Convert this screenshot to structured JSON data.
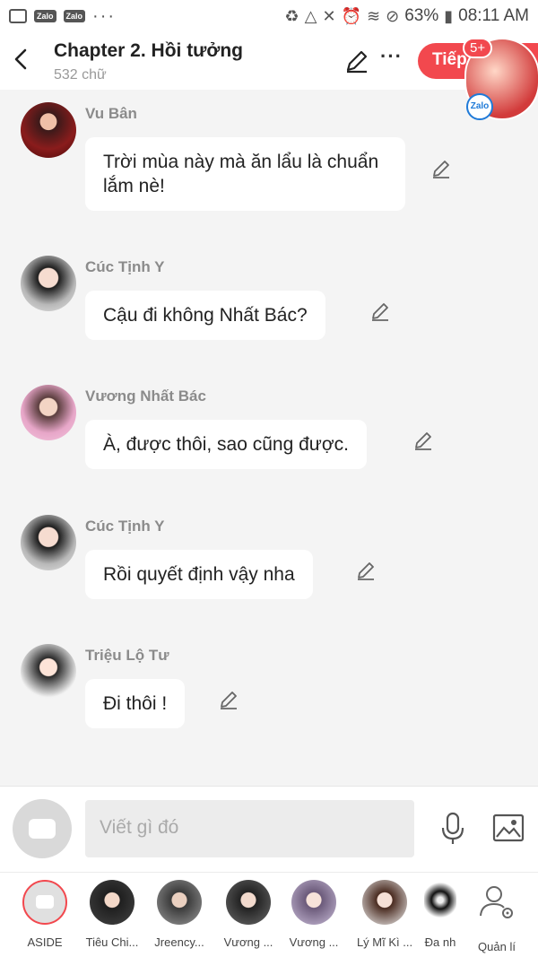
{
  "status_bar": {
    "zalo_label": "Zalo",
    "dots": "···",
    "battery": "63%",
    "time": "08:11 AM"
  },
  "header": {
    "title": "Chapter 2. Hồi tưởng",
    "subtitle": "532 chữ",
    "next_label": "Tiếp",
    "badge": "5+",
    "zalo_label": "Zalo"
  },
  "messages": [
    {
      "sender": "Vu Bân",
      "text": "Trời mùa này mà ăn lẩu là chuẩn lắm nè!"
    },
    {
      "sender": "Cúc Tịnh Y",
      "text": "Cậu đi không Nhất Bác?"
    },
    {
      "sender": "Vương Nhất Bác",
      "text": "À, được thôi, sao cũng được."
    },
    {
      "sender": "Cúc Tịnh Y",
      "text": "Rồi quyết định vậy nha"
    },
    {
      "sender": "Triệu Lộ Tư",
      "text": "Đi thôi !"
    }
  ],
  "composer": {
    "placeholder": "Viết gì đó"
  },
  "characters": [
    {
      "name": "ASIDE"
    },
    {
      "name": "Tiêu Chi..."
    },
    {
      "name": "Jreency..."
    },
    {
      "name": "Vương ..."
    },
    {
      "name": "Vương ..."
    },
    {
      "name": "Lý Mĩ Kì ..."
    },
    {
      "name": "Đa nh"
    },
    {
      "name": "Quản lí"
    }
  ],
  "colors": {
    "accent": "#f2484e",
    "background": "#f4f4f4",
    "bubble": "#ffffff"
  }
}
